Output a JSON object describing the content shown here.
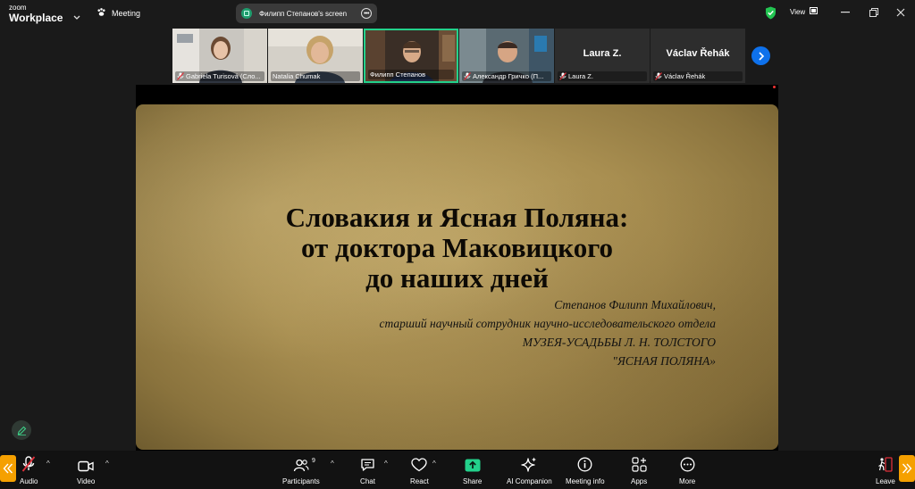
{
  "app": {
    "brand_top": "zoom",
    "brand_bottom": "Workplace",
    "meeting_label": "Meeting",
    "screen_share_label": "Филипп Степанов's screen",
    "view_label": "View"
  },
  "participants": [
    {
      "name": "Gabriela Turisová (Сло...",
      "muted": true,
      "has_video": true
    },
    {
      "name": "Natalia Chumak",
      "muted": false,
      "has_video": true
    },
    {
      "name": "Филипп Степанов",
      "muted": false,
      "has_video": true,
      "active_speaker": true
    },
    {
      "name": "Александр Гричко (П...",
      "muted": true,
      "has_video": true
    },
    {
      "name": "Laura Z.",
      "display_name": "Laura Z.",
      "muted": true,
      "has_video": false
    },
    {
      "name": "Václav Řehák",
      "display_name": "Václav Řehák",
      "muted": true,
      "has_video": false
    }
  ],
  "slide": {
    "title_lines": [
      "Словакия и Ясная Поляна:",
      "от доктора Маковицкого",
      "до наших дней"
    ],
    "author_lines": [
      "Степанов Филипп Михайлович,",
      "старший научный сотрудник научно-исследовательского отдела",
      "МУЗЕЯ-УСАДЬБЫ Л. Н. ТОЛСТОГО",
      "\"ЯСНАЯ ПОЛЯНА»"
    ]
  },
  "toolbar": {
    "audio": "Audio",
    "video": "Video",
    "participants": "Participants",
    "participants_count": "9",
    "chat": "Chat",
    "react": "React",
    "share": "Share",
    "ai_companion": "AI Companion",
    "meeting_info": "Meeting info",
    "apps": "Apps",
    "more": "More",
    "leave": "Leave"
  },
  "colors": {
    "accent_blue": "#0e71eb",
    "share_green": "#23d18b",
    "active_border": "#23d18b",
    "muted_red": "#e0303a",
    "side_tab": "#f5a000",
    "slide_bg": "#a98f51"
  }
}
